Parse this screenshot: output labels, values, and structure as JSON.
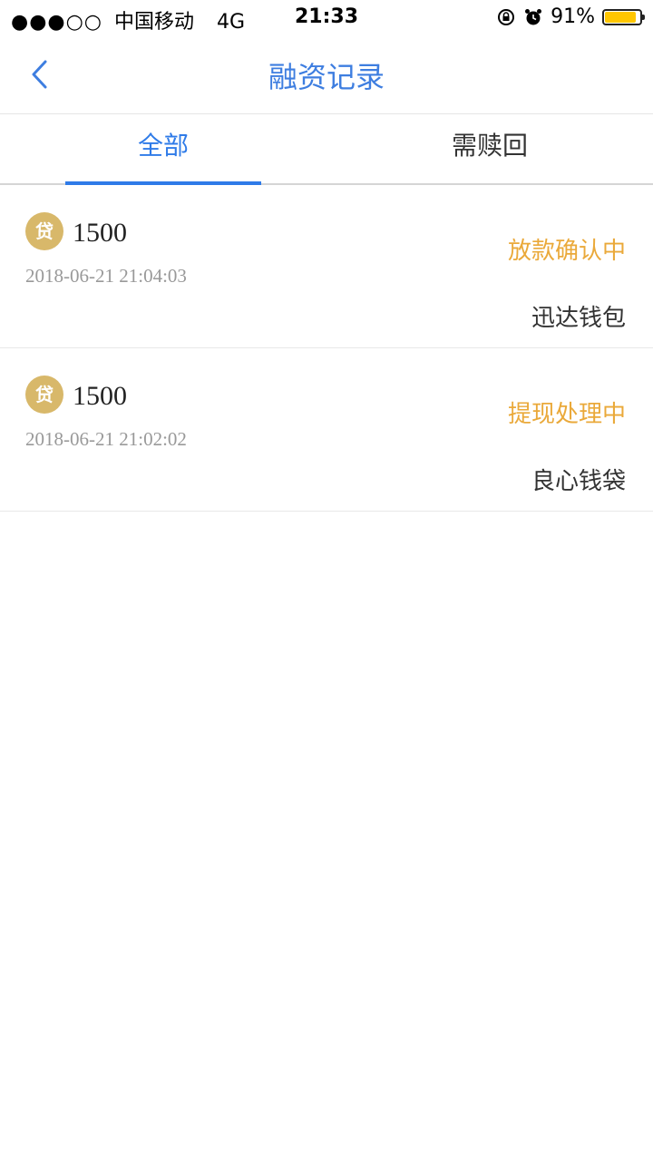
{
  "status_bar": {
    "signal": "●●●○○",
    "carrier": "中国移动",
    "network": "4G",
    "time": "21:33",
    "battery": "91%",
    "battery_level": 0.91,
    "battery_color": "#ffc600"
  },
  "nav": {
    "title": "融资记录",
    "back_icon": "chevron-left-icon"
  },
  "tabs": [
    {
      "label": "全部",
      "active": true
    },
    {
      "label": "需赎回",
      "active": false
    }
  ],
  "records": [
    {
      "icon_label": "贷",
      "amount": "1500",
      "time": "2018-06-21 21:04:03",
      "status": "放款确认中",
      "product": "迅达钱包"
    },
    {
      "icon_label": "贷",
      "amount": "1500",
      "time": "2018-06-21 21:02:02",
      "status": "提现处理中",
      "product": "良心钱袋"
    }
  ],
  "colors": {
    "accent": "#2f7be8",
    "status": "#eaa93a",
    "loan_icon": "#d8b86a"
  }
}
